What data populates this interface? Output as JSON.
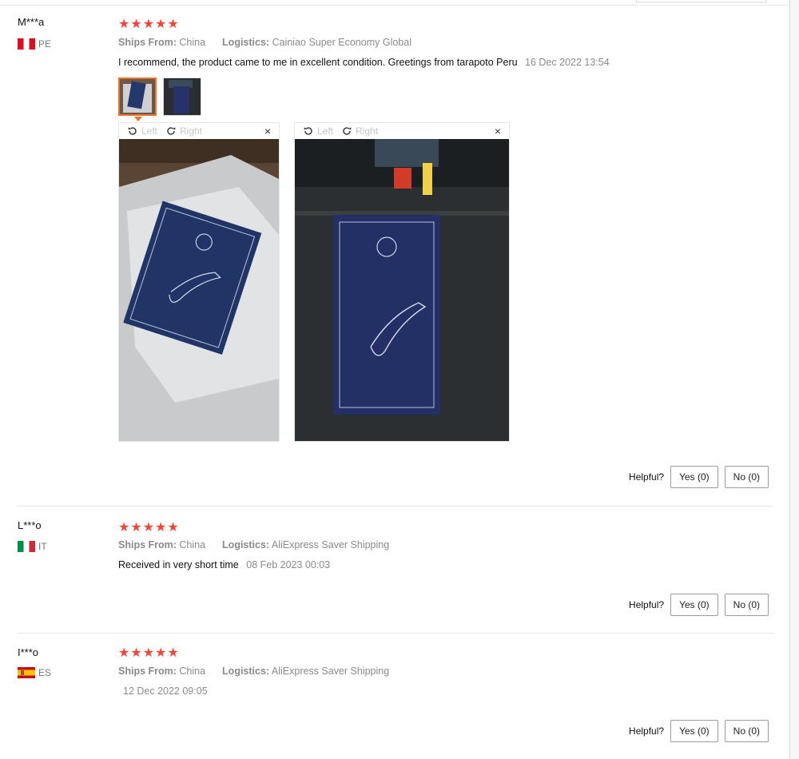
{
  "reviews": [
    {
      "user": "M***a",
      "country": "PE",
      "stars": "★★★★★",
      "ships_from_label": "Ships From:",
      "ships_from": "China",
      "logistics_label": "Logistics:",
      "logistics": "Cainiao Super Economy Global",
      "content": "I recommend, the product came to me in excellent condition. Greetings from tarapoto Peru",
      "date": "16 Dec 2022 13:54",
      "viewer": {
        "left_label": "Left",
        "right_label": "Right",
        "close": "×"
      },
      "helpful_label": "Helpful?",
      "yes_label": "Yes (0)",
      "no_label": "No (0)"
    },
    {
      "user": "L***o",
      "country": "IT",
      "stars": "★★★★★",
      "ships_from_label": "Ships From:",
      "ships_from": "China",
      "logistics_label": "Logistics:",
      "logistics": "AliExpress Saver Shipping",
      "content": "Received in very short time",
      "date": "08 Feb 2023 00:03",
      "helpful_label": "Helpful?",
      "yes_label": "Yes (0)",
      "no_label": "No (0)"
    },
    {
      "user": "I***o",
      "country": "ES",
      "stars": "★★★★★",
      "ships_from_label": "Ships From:",
      "ships_from": "China",
      "logistics_label": "Logistics:",
      "logistics": "AliExpress Saver Shipping",
      "content": "",
      "date": "12 Dec 2022 09:05",
      "helpful_label": "Helpful?",
      "yes_label": "Yes (0)",
      "no_label": "No (0)"
    }
  ],
  "colors": {
    "star": "#f2463a",
    "active_thumb": "#e9722e",
    "meta_text": "#8a8a8a"
  },
  "icons": [
    "rotate-left-icon",
    "rotate-right-icon",
    "close-icon",
    "star-icon",
    "flag-icon"
  ]
}
